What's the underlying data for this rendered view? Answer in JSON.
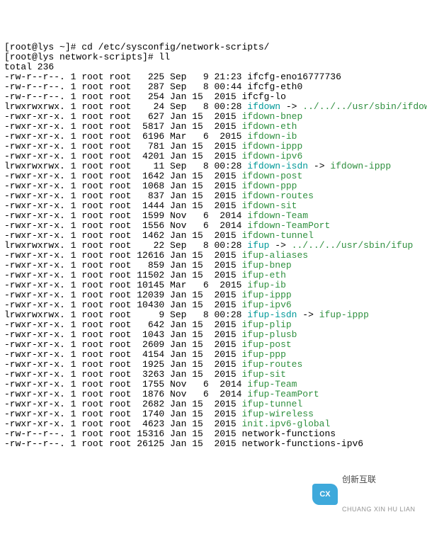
{
  "prompt1": "[root@lys ~]# ",
  "cmd1": "cd /etc/sysconfig/network-scripts/",
  "prompt2": "[root@lys network-scripts]# ",
  "cmd2": "ll",
  "total": "total 236",
  "rows": [
    {
      "perm": "-rw-r--r--.",
      "links": "1",
      "owner": "root",
      "group": "root",
      "size": "225",
      "date": "Sep   9 21:23",
      "name": "ifcfg-eno16777736",
      "cls": ""
    },
    {
      "perm": "-rw-r--r--.",
      "links": "1",
      "owner": "root",
      "group": "root",
      "size": "287",
      "date": "Sep   8 00:44",
      "name": "ifcfg-eth0",
      "cls": ""
    },
    {
      "perm": "-rw-r--r--.",
      "links": "1",
      "owner": "root",
      "group": "root",
      "size": "254",
      "date": "Jan 15  2015",
      "name": "ifcfg-lo",
      "cls": ""
    },
    {
      "perm": "lrwxrwxrwx.",
      "links": "1",
      "owner": "root",
      "group": "root",
      "size": "24",
      "date": "Sep   8 00:28",
      "name": "ifdown",
      "cls": "cyan",
      "arrow": " -> ",
      "target": "../../../usr/sbin/ifdown",
      "tcls": "green"
    },
    {
      "perm": "-rwxr-xr-x.",
      "links": "1",
      "owner": "root",
      "group": "root",
      "size": "627",
      "date": "Jan 15  2015",
      "name": "ifdown-bnep",
      "cls": "green"
    },
    {
      "perm": "-rwxr-xr-x.",
      "links": "1",
      "owner": "root",
      "group": "root",
      "size": "5817",
      "date": "Jan 15  2015",
      "name": "ifdown-eth",
      "cls": "green"
    },
    {
      "perm": "-rwxr-xr-x.",
      "links": "1",
      "owner": "root",
      "group": "root",
      "size": "6196",
      "date": "Mar   6  2015",
      "name": "ifdown-ib",
      "cls": "green"
    },
    {
      "perm": "-rwxr-xr-x.",
      "links": "1",
      "owner": "root",
      "group": "root",
      "size": "781",
      "date": "Jan 15  2015",
      "name": "ifdown-ippp",
      "cls": "green"
    },
    {
      "perm": "-rwxr-xr-x.",
      "links": "1",
      "owner": "root",
      "group": "root",
      "size": "4201",
      "date": "Jan 15  2015",
      "name": "ifdown-ipv6",
      "cls": "green"
    },
    {
      "perm": "lrwxrwxrwx.",
      "links": "1",
      "owner": "root",
      "group": "root",
      "size": "11",
      "date": "Sep   8 00:28",
      "name": "ifdown-isdn",
      "cls": "cyan",
      "arrow": " -> ",
      "target": "ifdown-ippp",
      "tcls": "green"
    },
    {
      "perm": "-rwxr-xr-x.",
      "links": "1",
      "owner": "root",
      "group": "root",
      "size": "1642",
      "date": "Jan 15  2015",
      "name": "ifdown-post",
      "cls": "green"
    },
    {
      "perm": "-rwxr-xr-x.",
      "links": "1",
      "owner": "root",
      "group": "root",
      "size": "1068",
      "date": "Jan 15  2015",
      "name": "ifdown-ppp",
      "cls": "green"
    },
    {
      "perm": "-rwxr-xr-x.",
      "links": "1",
      "owner": "root",
      "group": "root",
      "size": "837",
      "date": "Jan 15  2015",
      "name": "ifdown-routes",
      "cls": "green"
    },
    {
      "perm": "-rwxr-xr-x.",
      "links": "1",
      "owner": "root",
      "group": "root",
      "size": "1444",
      "date": "Jan 15  2015",
      "name": "ifdown-sit",
      "cls": "green"
    },
    {
      "perm": "-rwxr-xr-x.",
      "links": "1",
      "owner": "root",
      "group": "root",
      "size": "1599",
      "date": "Nov   6  2014",
      "name": "ifdown-Team",
      "cls": "green"
    },
    {
      "perm": "-rwxr-xr-x.",
      "links": "1",
      "owner": "root",
      "group": "root",
      "size": "1556",
      "date": "Nov   6  2014",
      "name": "ifdown-TeamPort",
      "cls": "green"
    },
    {
      "perm": "-rwxr-xr-x.",
      "links": "1",
      "owner": "root",
      "group": "root",
      "size": "1462",
      "date": "Jan 15  2015",
      "name": "ifdown-tunnel",
      "cls": "green"
    },
    {
      "perm": "lrwxrwxrwx.",
      "links": "1",
      "owner": "root",
      "group": "root",
      "size": "22",
      "date": "Sep   8 00:28",
      "name": "ifup",
      "cls": "cyan",
      "arrow": " -> ",
      "target": "../../../usr/sbin/ifup",
      "tcls": "green"
    },
    {
      "perm": "-rwxr-xr-x.",
      "links": "1",
      "owner": "root",
      "group": "root",
      "size": "12616",
      "date": "Jan 15  2015",
      "name": "ifup-aliases",
      "cls": "green"
    },
    {
      "perm": "-rwxr-xr-x.",
      "links": "1",
      "owner": "root",
      "group": "root",
      "size": "859",
      "date": "Jan 15  2015",
      "name": "ifup-bnep",
      "cls": "green"
    },
    {
      "perm": "-rwxr-xr-x.",
      "links": "1",
      "owner": "root",
      "group": "root",
      "size": "11502",
      "date": "Jan 15  2015",
      "name": "ifup-eth",
      "cls": "green"
    },
    {
      "perm": "-rwxr-xr-x.",
      "links": "1",
      "owner": "root",
      "group": "root",
      "size": "10145",
      "date": "Mar   6  2015",
      "name": "ifup-ib",
      "cls": "green"
    },
    {
      "perm": "-rwxr-xr-x.",
      "links": "1",
      "owner": "root",
      "group": "root",
      "size": "12039",
      "date": "Jan 15  2015",
      "name": "ifup-ippp",
      "cls": "green"
    },
    {
      "perm": "-rwxr-xr-x.",
      "links": "1",
      "owner": "root",
      "group": "root",
      "size": "10430",
      "date": "Jan 15  2015",
      "name": "ifup-ipv6",
      "cls": "green"
    },
    {
      "perm": "lrwxrwxrwx.",
      "links": "1",
      "owner": "root",
      "group": "root",
      "size": "9",
      "date": "Sep   8 00:28",
      "name": "ifup-isdn",
      "cls": "cyan",
      "arrow": " -> ",
      "target": "ifup-ippp",
      "tcls": "green"
    },
    {
      "perm": "-rwxr-xr-x.",
      "links": "1",
      "owner": "root",
      "group": "root",
      "size": "642",
      "date": "Jan 15  2015",
      "name": "ifup-plip",
      "cls": "green"
    },
    {
      "perm": "-rwxr-xr-x.",
      "links": "1",
      "owner": "root",
      "group": "root",
      "size": "1043",
      "date": "Jan 15  2015",
      "name": "ifup-plusb",
      "cls": "green"
    },
    {
      "perm": "-rwxr-xr-x.",
      "links": "1",
      "owner": "root",
      "group": "root",
      "size": "2609",
      "date": "Jan 15  2015",
      "name": "ifup-post",
      "cls": "green"
    },
    {
      "perm": "-rwxr-xr-x.",
      "links": "1",
      "owner": "root",
      "group": "root",
      "size": "4154",
      "date": "Jan 15  2015",
      "name": "ifup-ppp",
      "cls": "green"
    },
    {
      "perm": "-rwxr-xr-x.",
      "links": "1",
      "owner": "root",
      "group": "root",
      "size": "1925",
      "date": "Jan 15  2015",
      "name": "ifup-routes",
      "cls": "green"
    },
    {
      "perm": "-rwxr-xr-x.",
      "links": "1",
      "owner": "root",
      "group": "root",
      "size": "3263",
      "date": "Jan 15  2015",
      "name": "ifup-sit",
      "cls": "green"
    },
    {
      "perm": "-rwxr-xr-x.",
      "links": "1",
      "owner": "root",
      "group": "root",
      "size": "1755",
      "date": "Nov   6  2014",
      "name": "ifup-Team",
      "cls": "green"
    },
    {
      "perm": "-rwxr-xr-x.",
      "links": "1",
      "owner": "root",
      "group": "root",
      "size": "1876",
      "date": "Nov   6  2014",
      "name": "ifup-TeamPort",
      "cls": "green"
    },
    {
      "perm": "-rwxr-xr-x.",
      "links": "1",
      "owner": "root",
      "group": "root",
      "size": "2682",
      "date": "Jan 15  2015",
      "name": "ifup-tunnel",
      "cls": "green"
    },
    {
      "perm": "-rwxr-xr-x.",
      "links": "1",
      "owner": "root",
      "group": "root",
      "size": "1740",
      "date": "Jan 15  2015",
      "name": "ifup-wireless",
      "cls": "green"
    },
    {
      "perm": "-rwxr-xr-x.",
      "links": "1",
      "owner": "root",
      "group": "root",
      "size": "4623",
      "date": "Jan 15  2015",
      "name": "init.ipv6-global",
      "cls": "green"
    },
    {
      "perm": "-rw-r--r--.",
      "links": "1",
      "owner": "root",
      "group": "root",
      "size": "15316",
      "date": "Jan 15  2015",
      "name": "network-functions",
      "cls": ""
    },
    {
      "perm": "-rw-r--r--.",
      "links": "1",
      "owner": "root",
      "group": "root",
      "size": "26125",
      "date": "Jan 15  2015",
      "name": "network-functions-ipv6",
      "cls": ""
    }
  ],
  "watermark": {
    "brand": "CX",
    "text": "创新互联",
    "sub": "CHUANG XIN HU LIAN"
  }
}
